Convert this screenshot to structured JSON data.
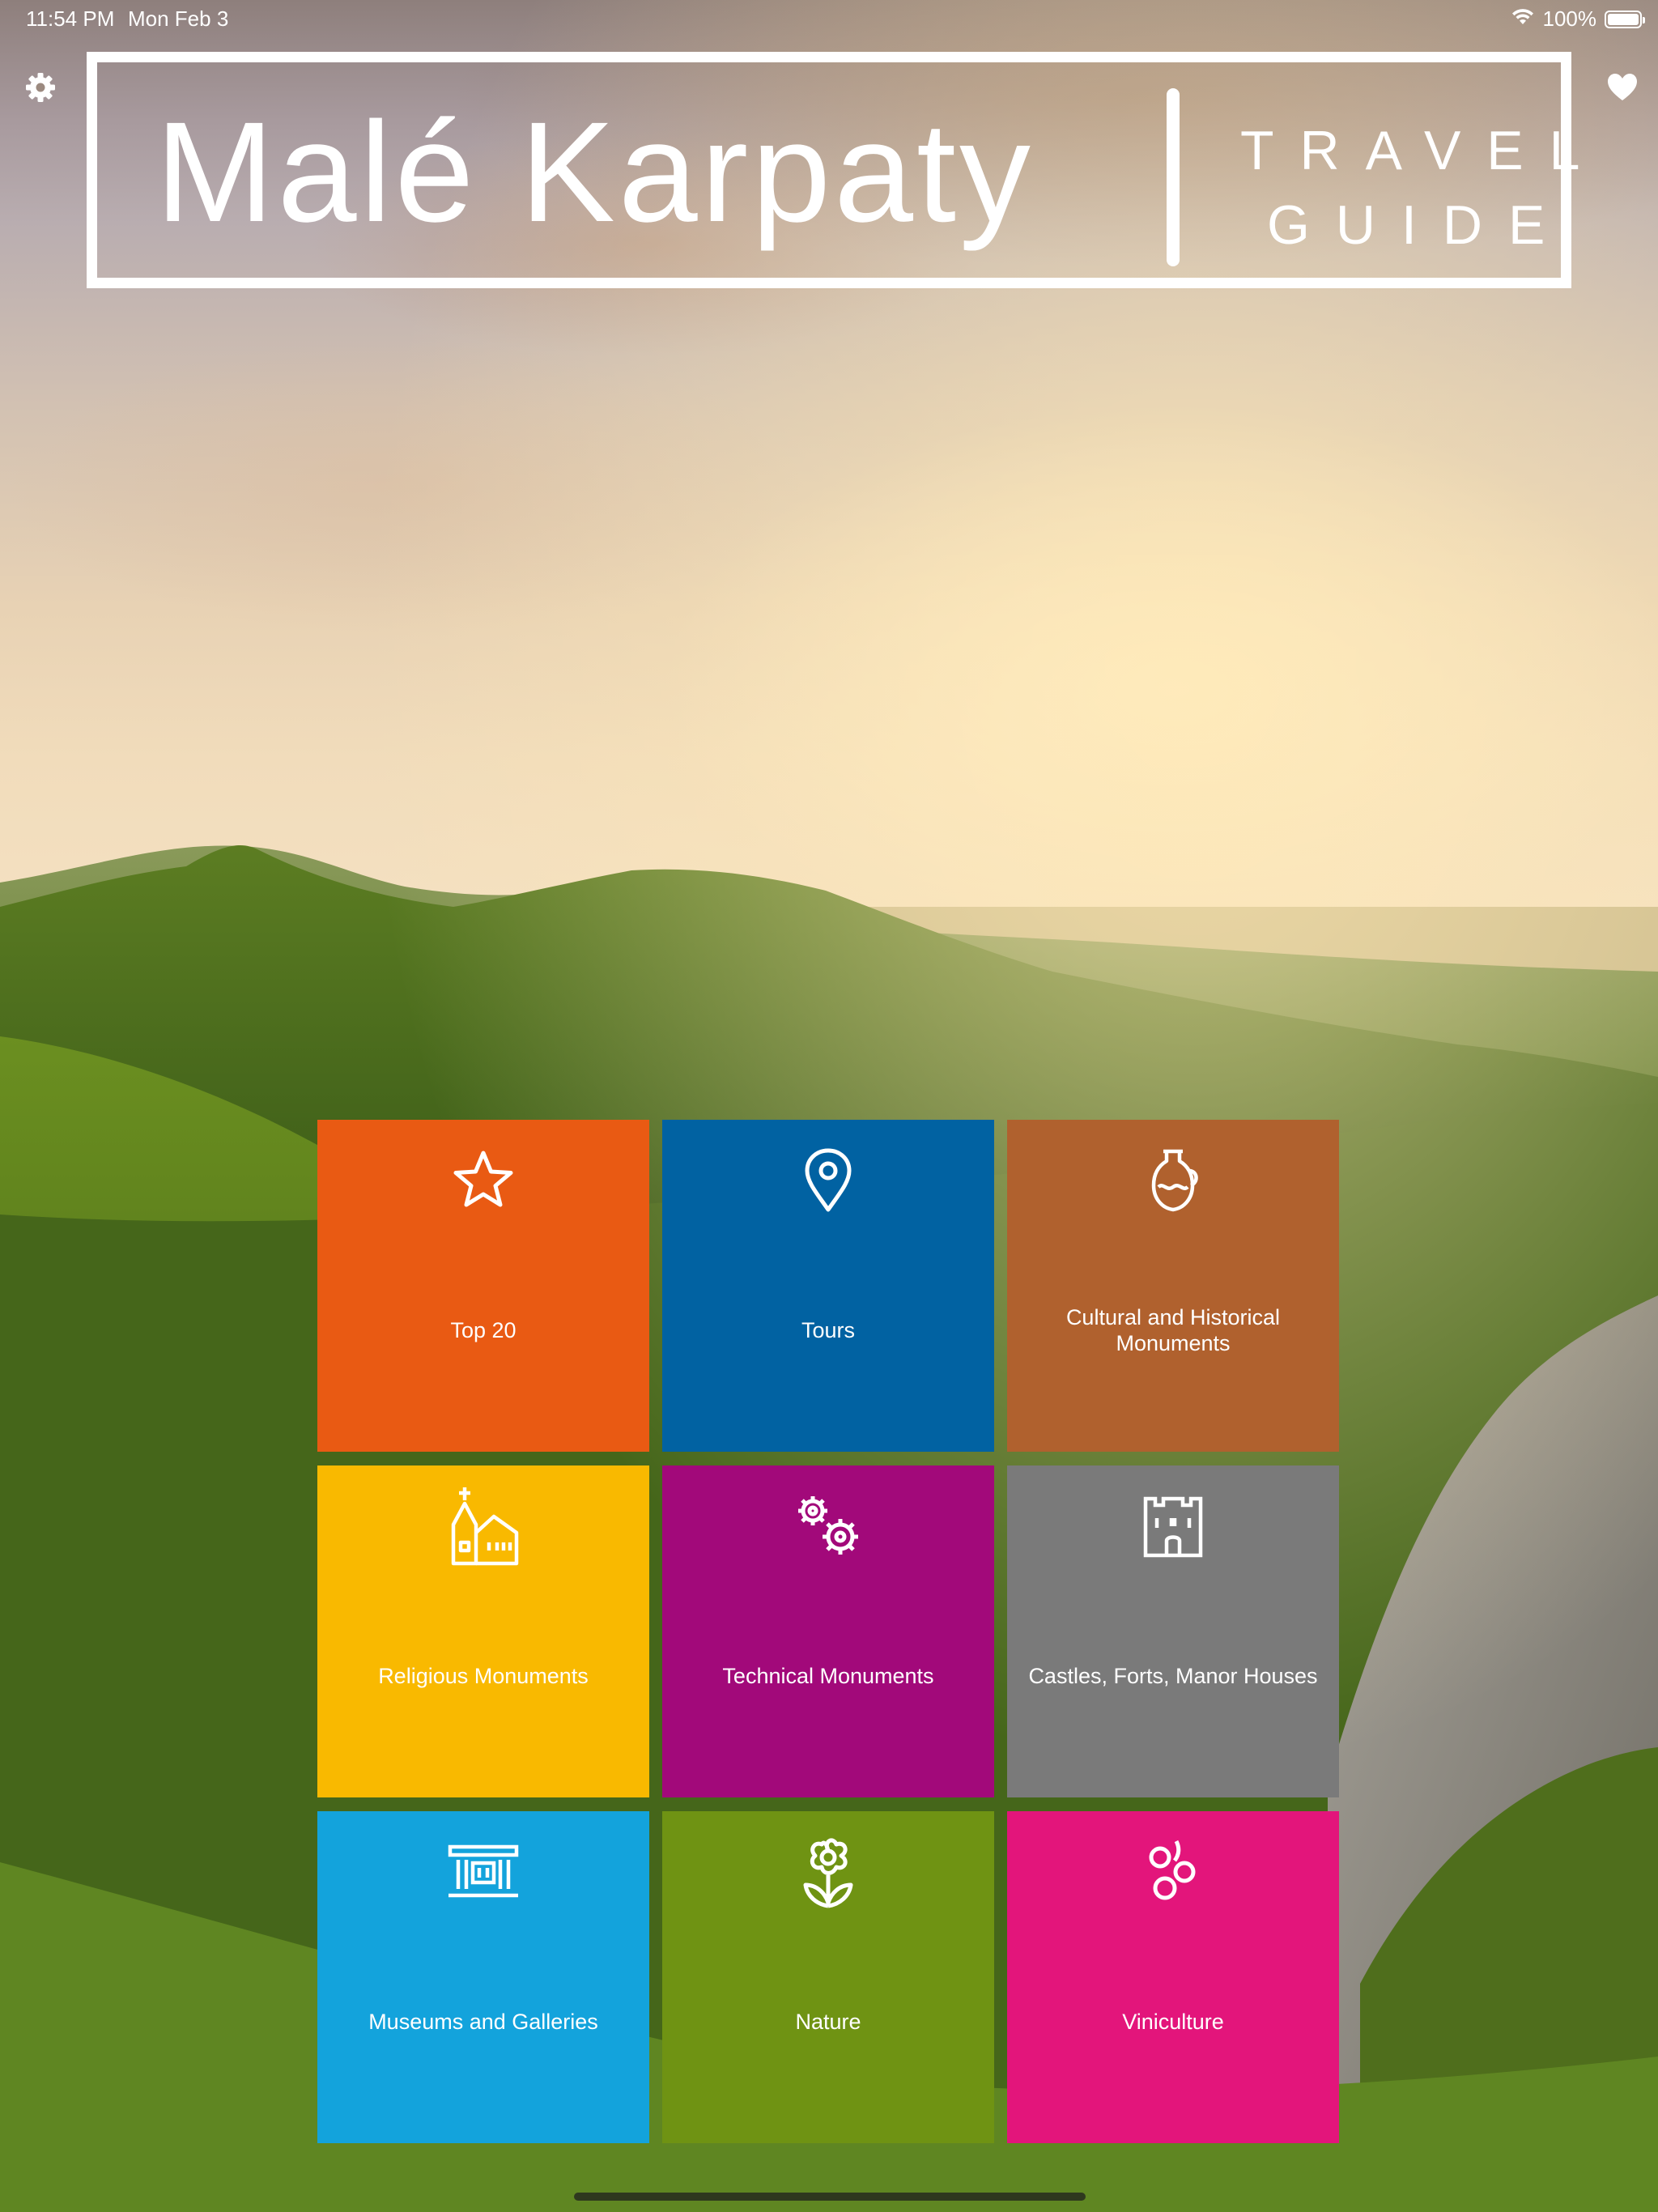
{
  "status_bar": {
    "time": "11:54 PM",
    "date": "Mon Feb 3",
    "battery_text": "100%",
    "battery_level": 1.0,
    "wifi_icon": "wifi-icon",
    "battery_icon": "battery-icon"
  },
  "toolbar": {
    "settings_icon": "gear-icon",
    "favorites_icon": "heart-icon"
  },
  "logo": {
    "title": "Malé Karpaty",
    "sub_line1": "TRAVEL",
    "sub_line2": "GUIDE"
  },
  "colors": {
    "top20": "#e95a13",
    "tours": "#0162a2",
    "cultural": "#b0612e",
    "religious": "#f9b900",
    "technical": "#a2097a",
    "castles": "#7a7a7a",
    "museums": "#13a3dc",
    "nature": "#6f9313",
    "viniculture": "#e3157b"
  },
  "tiles": [
    {
      "label": "Top 20",
      "icon": "star-icon"
    },
    {
      "label": "Tours",
      "icon": "map-pin-icon"
    },
    {
      "label": "Cultural and Historical Monuments",
      "icon": "amphora-icon"
    },
    {
      "label": "Religious Monuments",
      "icon": "church-icon"
    },
    {
      "label": "Technical Monuments",
      "icon": "gears-icon"
    },
    {
      "label": "Castles, Forts, Manor Houses",
      "icon": "castle-icon"
    },
    {
      "label": "Museums and Galleries",
      "icon": "museum-icon"
    },
    {
      "label": "Nature",
      "icon": "flower-icon"
    },
    {
      "label": "Viniculture",
      "icon": "grapes-icon"
    }
  ]
}
